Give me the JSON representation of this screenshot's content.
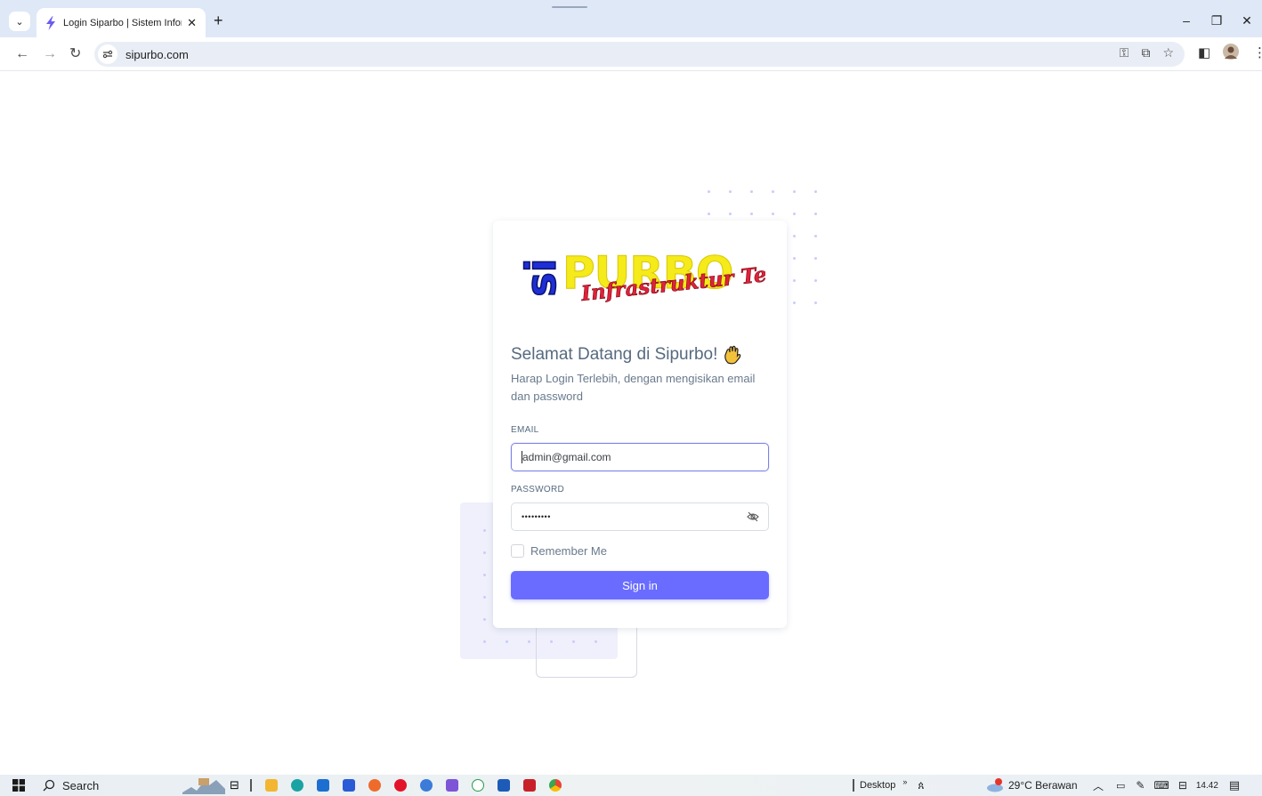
{
  "browser": {
    "tab_title": "Login Siparbo | Sistem Informasi",
    "tab_close": "✕",
    "new_tab": "+",
    "url": "sipurbo.com",
    "window_controls": [
      "–",
      "❐",
      "✕"
    ]
  },
  "login": {
    "logo_text_main": "PURBO",
    "logo_text_prefix": "si",
    "logo_text_script": "Infrastruktur Tebo",
    "welcome": "Selamat Datang di Sipurbo!",
    "subtitle": "Harap Login Terlebih, dengan mengisikan email dan password",
    "email_label": "EMAIL",
    "email_value": "admin@gmail.com",
    "password_label": "PASSWORD",
    "password_value": "•••••••••",
    "remember_label": "Remember Me",
    "signin_label": "Sign in"
  },
  "taskbar": {
    "search_label": "Search",
    "desktop_label": "Desktop",
    "weather": "29°C  Berawan",
    "time": "14.42"
  },
  "colors": {
    "primary": "#696cff",
    "heading": "#566a7f",
    "body_text": "#697a8d",
    "logo_blue": "#1f2fd6",
    "logo_yellow": "#f5ea1a",
    "logo_red": "#e0213a"
  }
}
